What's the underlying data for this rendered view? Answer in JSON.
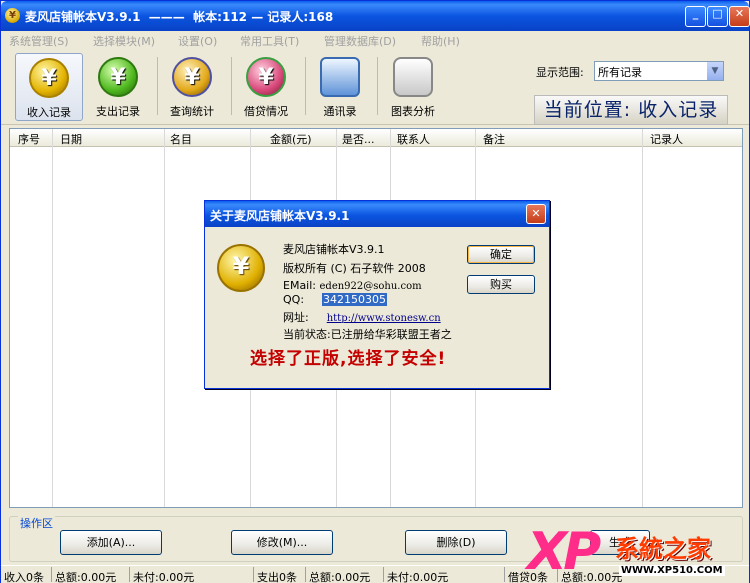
{
  "window": {
    "title": "麦风店铺帐本V3.9.1  ———  帐本:112 — 记录人:168",
    "min_label": "_",
    "max_label": "□",
    "close_label": "✕"
  },
  "menu": [
    "系统管理(S)",
    "选择模块(M)",
    "设置(O)",
    "常用工具(T)",
    "管理数据库(D)",
    "帮助(H)"
  ],
  "toolbar": {
    "items": [
      {
        "label": "收入记录",
        "icon": "yen-income-icon",
        "symbol": "¥"
      },
      {
        "label": "支出记录",
        "icon": "yen-expense-icon",
        "symbol": "¥"
      },
      {
        "label": "查询统计",
        "icon": "search-stats-icon",
        "symbol": "¥"
      },
      {
        "label": "借贷情况",
        "icon": "loan-icon",
        "symbol": "¥"
      },
      {
        "label": "通讯录",
        "icon": "address-book-icon",
        "symbol": ""
      },
      {
        "label": "图表分析",
        "icon": "chart-icon",
        "symbol": ""
      }
    ],
    "range_label": "显示范围:",
    "range_value": "所有记录",
    "range_arrow": "▼",
    "location": "当前位置: 收入记录"
  },
  "grid": {
    "columns": [
      "序号",
      "日期",
      "名目",
      "金额(元)",
      "是否...",
      "联系人",
      "备注",
      "记录人"
    ]
  },
  "dialog": {
    "title": "关于麦风店铺帐本V3.9.1",
    "close_label": "✕",
    "coin_symbol": "¥",
    "product": "麦风店铺帐本V3.9.1",
    "copyright": "版权所有 (C) 石子软件 2008",
    "email_label": "EMail:",
    "email_value": "eden922@sohu.com",
    "qq_label": "QQ:",
    "qq_value": "342150305",
    "url_label": "网址:",
    "url_value": "http://www.stonesw.cn",
    "status": "当前状态:已注册给华彩联盟王者之",
    "slogan": "选择了正版,选择了安全!",
    "ok_label": "确定",
    "buy_label": "购买"
  },
  "ops": {
    "label": "操作区",
    "add": "添加(A)...",
    "edit": "修改(M)...",
    "delete": "删除(D)",
    "generate": "生成"
  },
  "status": {
    "income_count": "收入0条",
    "income_total": "总额:0.00元",
    "income_unpaid": "未付:0.00元",
    "expense_count": "支出0条",
    "expense_total": "总额:0.00元",
    "expense_unpaid": "未付:0.00元",
    "loan_count": "借贷0条",
    "loan_total": "总额:0.00元"
  },
  "watermark": {
    "xp": "XP",
    "name": "系統之家",
    "url": "WWW.XP510.COM"
  }
}
